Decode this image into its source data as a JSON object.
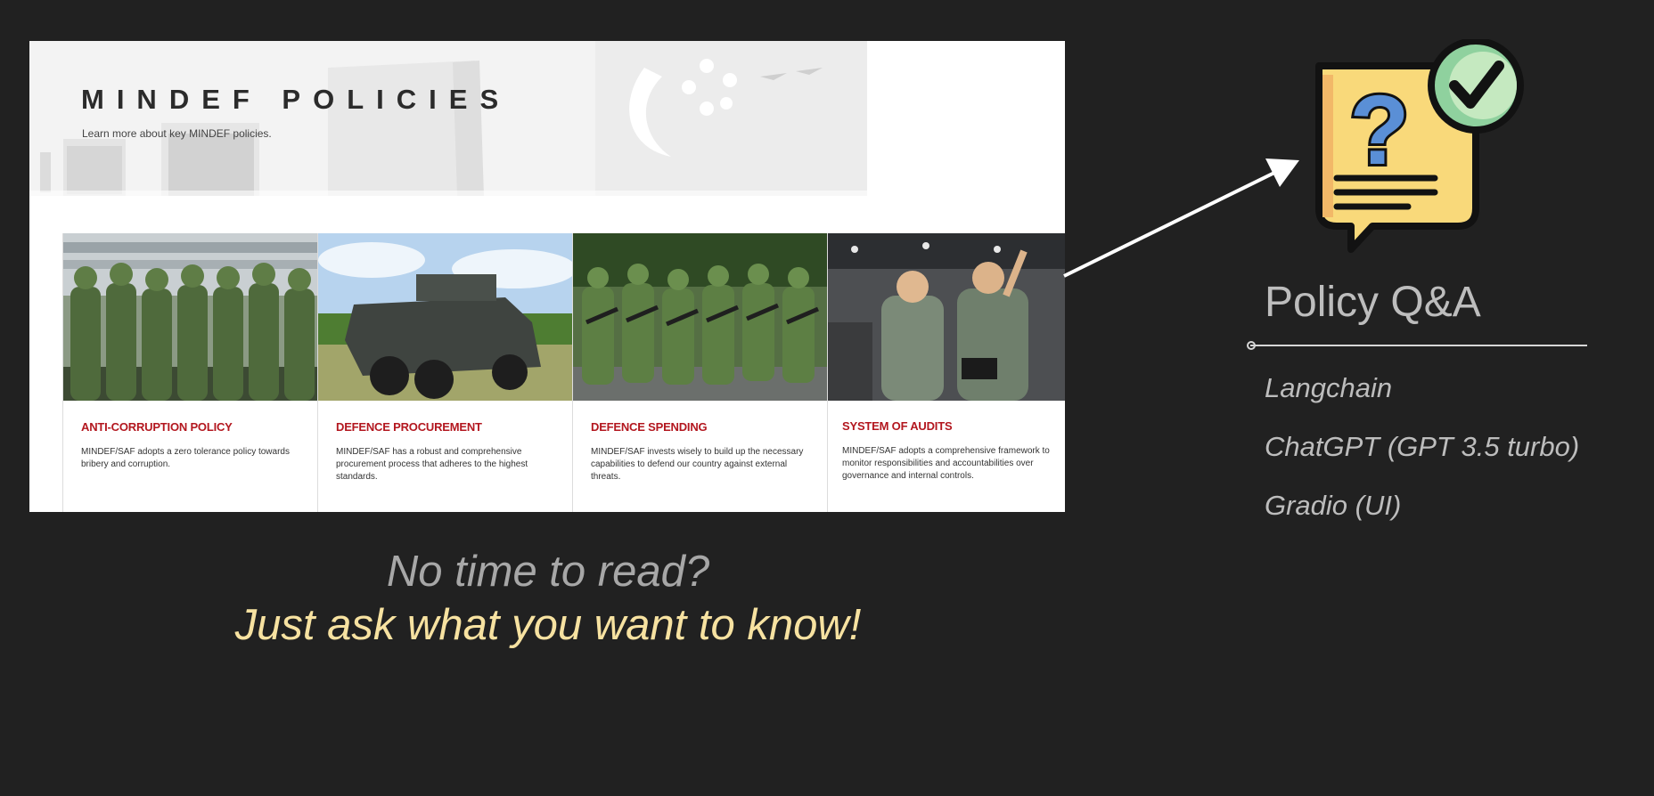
{
  "screenshot": {
    "banner": {
      "title": "MINDEF POLICIES",
      "subtitle": "Learn more about key MINDEF policies."
    },
    "cards": [
      {
        "title": "ANTI-CORRUPTION POLICY",
        "description": "MINDEF/SAF adopts a zero tolerance policy towards bribery and corruption.",
        "image": "soldiers-saluting-photo"
      },
      {
        "title": "DEFENCE PROCUREMENT",
        "description": "MINDEF/SAF has a robust and comprehensive procurement process that adheres to the highest standards.",
        "image": "armoured-vehicle-photo"
      },
      {
        "title": "DEFENCE SPENDING",
        "description": "MINDEF/SAF invests wisely to build up the necessary capabilities to defend our country against external threats.",
        "image": "soldiers-marching-photo"
      },
      {
        "title": "SYSTEM OF AUDITS",
        "description": "MINDEF/SAF adopts a comprehensive framework to monitor responsibilities and accountabilities over governance and internal controls.",
        "image": "officers-pointing-photo"
      }
    ]
  },
  "caption": {
    "line1": "No time to read?",
    "line2": "Just ask what you want to know!"
  },
  "qa": {
    "title": "Policy Q&A",
    "icon": "question-chat-check-icon",
    "tech": [
      "Langchain",
      "ChatGPT (GPT 3.5 turbo)",
      "Gradio (UI)"
    ]
  },
  "colors": {
    "background": "#212121",
    "card_title": "#b3171f",
    "caption_highlight": "#f7e2a1",
    "caption_muted": "#a7a7a7",
    "icon_yellow": "#f9d97a",
    "icon_blue": "#5a8fd6",
    "icon_green": "#8fd19e"
  }
}
